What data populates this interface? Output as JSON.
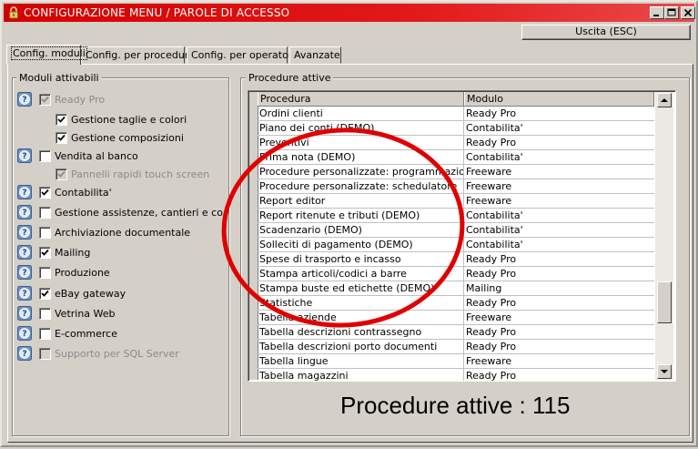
{
  "window": {
    "title": "CONFIGURAZIONE MENU / PAROLE DI ACCESSO",
    "title_color": "#d40000"
  },
  "toolbar": {
    "exit_label": "Uscita (ESC)"
  },
  "tabs": [
    {
      "label": "Config. moduli",
      "active": true
    },
    {
      "label": "Config. per procedura",
      "active": false
    },
    {
      "label": "Config. per operatore",
      "active": false
    },
    {
      "label": "Avanzate",
      "active": false
    }
  ],
  "modules": {
    "group_label": "Moduli attivabili",
    "items": [
      {
        "label": "Ready Pro",
        "checked": true,
        "enabled": false,
        "help_icon": true,
        "indent": false
      },
      {
        "label": "Gestione taglie e colori",
        "checked": true,
        "enabled": true,
        "help_icon": false,
        "indent": true
      },
      {
        "label": "Gestione composizioni",
        "checked": true,
        "enabled": true,
        "help_icon": false,
        "indent": true
      },
      {
        "label": "Vendita al banco",
        "checked": false,
        "enabled": true,
        "help_icon": true,
        "indent": false
      },
      {
        "label": "Pannelli rapidi touch screen",
        "checked": true,
        "enabled": false,
        "help_icon": false,
        "indent": true
      },
      {
        "label": "Contabilita'",
        "checked": true,
        "enabled": true,
        "help_icon": true,
        "indent": false
      },
      {
        "label": "Gestione assistenze, cantieri e contratti",
        "checked": false,
        "enabled": true,
        "help_icon": true,
        "indent": false
      },
      {
        "label": "Archiviazione documentale",
        "checked": false,
        "enabled": true,
        "help_icon": true,
        "indent": false
      },
      {
        "label": "Mailing",
        "checked": true,
        "enabled": true,
        "help_icon": true,
        "indent": false
      },
      {
        "label": "Produzione",
        "checked": false,
        "enabled": true,
        "help_icon": true,
        "indent": false
      },
      {
        "label": "eBay gateway",
        "checked": true,
        "enabled": true,
        "help_icon": true,
        "indent": false
      },
      {
        "label": "Vetrina Web",
        "checked": false,
        "enabled": true,
        "help_icon": true,
        "indent": false
      },
      {
        "label": "E-commerce",
        "checked": false,
        "enabled": true,
        "help_icon": true,
        "indent": false
      },
      {
        "label": "Supporto per SQL Server",
        "checked": false,
        "enabled": false,
        "help_icon": true,
        "indent": false
      }
    ]
  },
  "procedures": {
    "group_label": "Procedure attive",
    "columns": [
      "Procedura",
      "Modulo"
    ],
    "rows": [
      [
        "Ordini clienti",
        "Ready Pro"
      ],
      [
        "Piano dei conti (DEMO)",
        "Contabilita'"
      ],
      [
        "Preventivi",
        "Ready Pro"
      ],
      [
        "Prima nota (DEMO)",
        "Contabilita'"
      ],
      [
        "Procedure personalizzate: programmazione",
        "Freeware"
      ],
      [
        "Procedure personalizzate: schedulatore",
        "Freeware"
      ],
      [
        "Report editor",
        "Freeware"
      ],
      [
        "Report ritenute e tributi (DEMO)",
        "Contabilita'"
      ],
      [
        "Scadenzario (DEMO)",
        "Contabilita'"
      ],
      [
        "Solleciti di pagamento (DEMO)",
        "Contabilita'"
      ],
      [
        "Spese di trasporto e incasso",
        "Ready Pro"
      ],
      [
        "Stampa articoli/codici a barre",
        "Ready Pro"
      ],
      [
        "Stampa buste ed etichette (DEMO)",
        "Mailing"
      ],
      [
        "Statistiche",
        "Ready Pro"
      ],
      [
        "Tabella aziende",
        "Freeware"
      ],
      [
        "Tabella descrizioni contrassegno",
        "Ready Pro"
      ],
      [
        "Tabella descrizioni porto documenti",
        "Ready Pro"
      ],
      [
        "Tabella lingue",
        "Freeware"
      ],
      [
        "Tabella magazzini",
        "Ready Pro"
      ]
    ],
    "count_text": "Procedure attive : 115"
  },
  "annotation": {
    "color": "#e00000"
  }
}
